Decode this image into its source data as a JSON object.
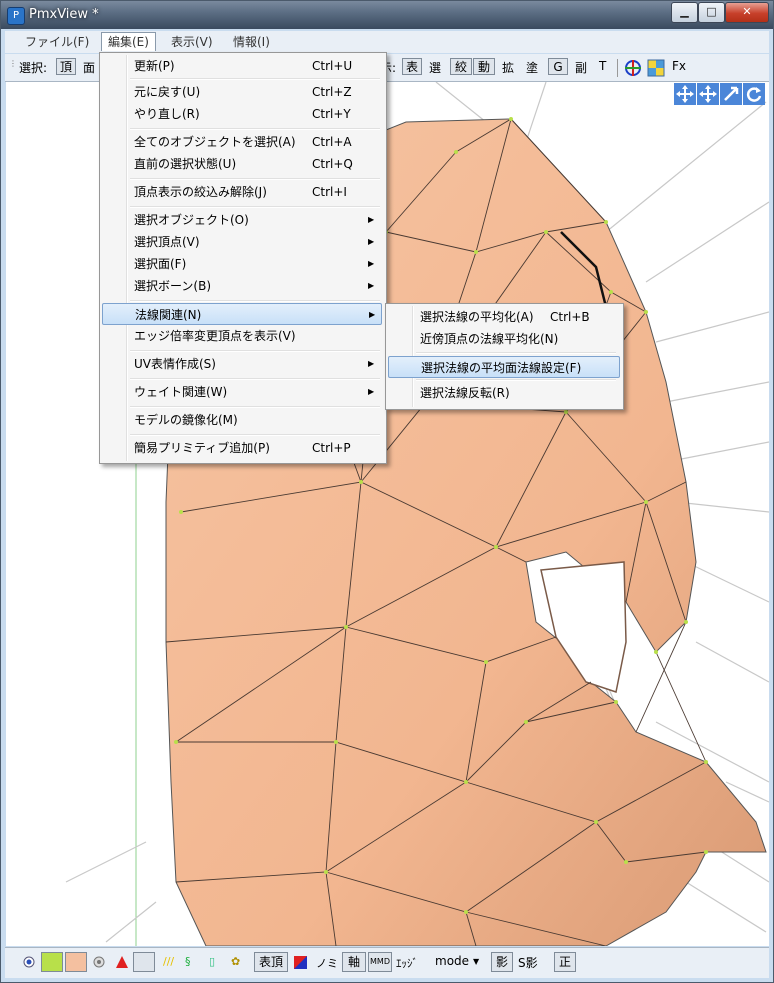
{
  "window": {
    "title": "PmxView *",
    "min": "▁",
    "max": "□",
    "close": "✕"
  },
  "menubar": {
    "items": [
      "ファイル(F)",
      "編集(E)",
      "表示(V)",
      "情報(I)"
    ]
  },
  "toolbar": {
    "select_label": "選択:",
    "vertex": "頂",
    "face": "面",
    "display_label": "示:",
    "items": [
      "表",
      "選",
      "絞",
      "動",
      "拡",
      "塗",
      "G",
      "副",
      "T"
    ],
    "fx": "Fx"
  },
  "edit_menu": {
    "items": [
      {
        "label": "更新(P)",
        "shortcut": "Ctrl+U"
      },
      {
        "label": "元に戻す(U)",
        "shortcut": "Ctrl+Z"
      },
      {
        "label": "やり直し(R)",
        "shortcut": "Ctrl+Y"
      },
      {
        "label": "全てのオブジェクトを選択(A)",
        "shortcut": "Ctrl+A"
      },
      {
        "label": "直前の選択状態(U)",
        "shortcut": "Ctrl+Q"
      },
      {
        "label": "頂点表示の絞込み解除(J)",
        "shortcut": "Ctrl+I"
      },
      {
        "label": "選択オブジェクト(O)",
        "shortcut": ""
      },
      {
        "label": "選択頂点(V)",
        "shortcut": ""
      },
      {
        "label": "選択面(F)",
        "shortcut": ""
      },
      {
        "label": "選択ボーン(B)",
        "shortcut": ""
      },
      {
        "label": "法線関連(N)",
        "shortcut": ""
      },
      {
        "label": "エッジ倍率変更頂点を表示(V)",
        "shortcut": ""
      },
      {
        "label": "UV表情作成(S)",
        "shortcut": ""
      },
      {
        "label": "ウェイト関連(W)",
        "shortcut": ""
      },
      {
        "label": "モデルの鏡像化(M)",
        "shortcut": ""
      },
      {
        "label": "簡易プリミティブ追加(P)",
        "shortcut": "Ctrl+P"
      }
    ]
  },
  "normal_submenu": {
    "items": [
      {
        "label": "選択法線の平均化(A)",
        "shortcut": "Ctrl+B"
      },
      {
        "label": "近傍頂点の法線平均化(N)",
        "shortcut": ""
      },
      {
        "label": "選択法線の平均面法線設定(F)",
        "shortcut": ""
      },
      {
        "label": "選択法線反転(R)",
        "shortcut": ""
      }
    ]
  },
  "statusbar": {
    "surface_vertex": "表頂",
    "nomi": "ノミ",
    "axis": "軸",
    "mmd": "MMD",
    "edge": "ｴｯｼﾞ",
    "mode": "mode",
    "shadow": "影",
    "sshadow": "S影",
    "correct": "正"
  },
  "colors": {
    "skin": "#f4b994",
    "menu_highlight": "#c8e0f8",
    "title_bar": "#5c6e84"
  }
}
